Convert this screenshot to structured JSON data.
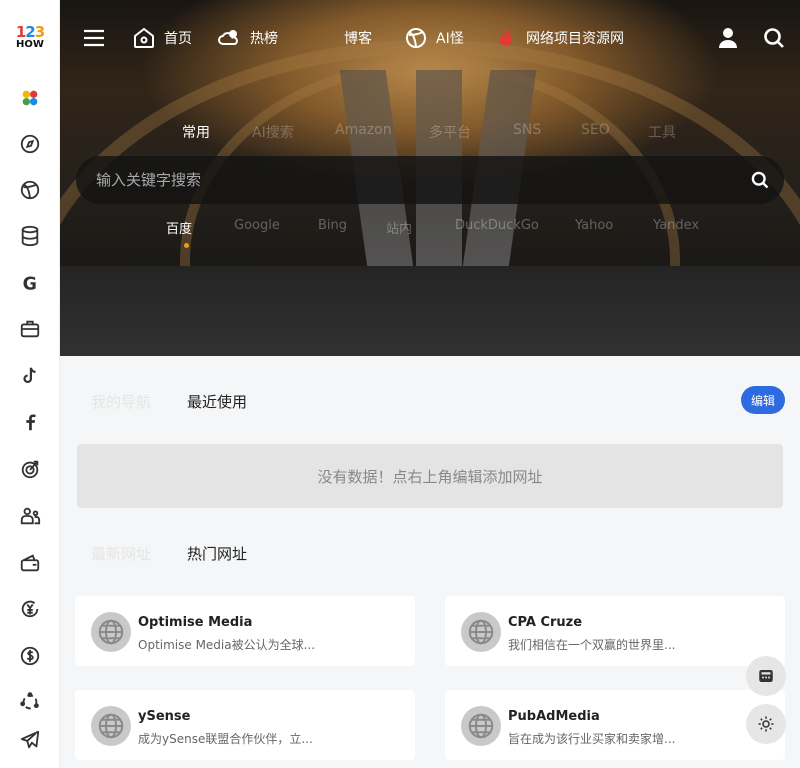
{
  "logo": {
    "digit1": "1",
    "digit2": "2",
    "digit3": "3",
    "word": "HOW"
  },
  "sidebar": {
    "items": [
      {
        "icon": "apps-icon"
      },
      {
        "icon": "compass-icon"
      },
      {
        "icon": "ball-icon"
      },
      {
        "icon": "database-icon"
      },
      {
        "icon": "google-icon"
      },
      {
        "icon": "briefcase-icon"
      },
      {
        "icon": "tiktok-icon"
      },
      {
        "icon": "facebook-icon"
      },
      {
        "icon": "target-icon"
      },
      {
        "icon": "users-icon"
      },
      {
        "icon": "wallet-icon"
      },
      {
        "icon": "yen-icon"
      },
      {
        "icon": "dollar-icon"
      },
      {
        "icon": "orbit-icon"
      },
      {
        "icon": "send-icon"
      }
    ]
  },
  "nav": {
    "home": "首页",
    "hot": "热榜",
    "blog": "博客",
    "ai": "AI怪",
    "resource": "网络项目资源网"
  },
  "search": {
    "categories": [
      "常用",
      "AI搜索",
      "Amazon",
      "多平台",
      "SNS",
      "SEO",
      "工具"
    ],
    "placeholder": "输入关键字搜索",
    "engines": [
      "百度",
      "Google",
      "Bing",
      "站内",
      "DuckDuckGo",
      "Yahoo",
      "Yandex"
    ]
  },
  "nav_section": {
    "tab1": "我的导航",
    "tab2": "最近使用",
    "edit": "编辑",
    "empty": "没有数据！点右上角编辑添加网址"
  },
  "sites_section": {
    "tab1": "最新网址",
    "tab2": "热门网址"
  },
  "cards": [
    {
      "title": "Optimise Media",
      "desc": "Optimise Media被公认为全球..."
    },
    {
      "title": "CPA Cruze",
      "desc": "我们相信在一个双赢的世界里..."
    },
    {
      "title": "ySense",
      "desc": "成为ySense联盟合作伙伴，立..."
    },
    {
      "title": "PubAdMedia",
      "desc": "旨在成为该行业买家和卖家增..."
    }
  ],
  "colors": {
    "accent": "#2f6be0",
    "sidebar_bg": "#ffffff",
    "page_bg": "#f5f6f7"
  }
}
